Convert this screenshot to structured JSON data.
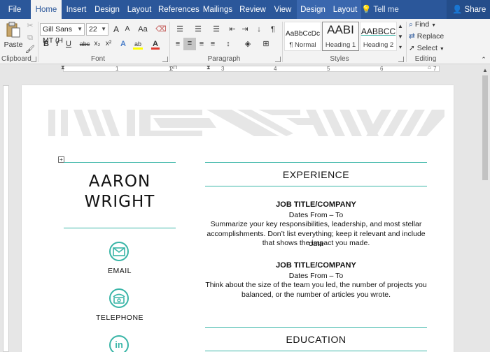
{
  "tabs": [
    {
      "label": "File"
    },
    {
      "label": "Home"
    },
    {
      "label": "Insert"
    },
    {
      "label": "Design"
    },
    {
      "label": "Layout"
    },
    {
      "label": "References"
    },
    {
      "label": "Mailings"
    },
    {
      "label": "Review"
    },
    {
      "label": "View"
    },
    {
      "label": "Design"
    },
    {
      "label": "Layout"
    }
  ],
  "tell_me": "Tell me",
  "share": "Share",
  "clipboard": {
    "paste": "Paste",
    "label": "Clipboard"
  },
  "font": {
    "name": "Gill Sans MT (H",
    "size": "22",
    "label": "Font",
    "bold": "B",
    "italic": "I",
    "underline": "U",
    "strike": "abc",
    "sub": "x₂",
    "sup": "x²",
    "grow": "A",
    "shrink": "A",
    "case": "Aa",
    "color_letter": "A",
    "highlight_letter": "ab"
  },
  "paragraph": {
    "label": "Paragraph",
    "pilcrow": "¶"
  },
  "styles": {
    "label": "Styles",
    "items": [
      {
        "sample": "AaBbCcDc",
        "name": "¶ Normal"
      },
      {
        "sample": "AABI",
        "name": "Heading 1"
      },
      {
        "sample": "AABBCC",
        "name": "Heading 2"
      }
    ]
  },
  "editing": {
    "label": "Editing",
    "find": "Find",
    "replace": "Replace",
    "select": "Select"
  },
  "ruler": {
    "numbers": [
      "1",
      "1",
      "2",
      "3",
      "4",
      "5",
      "6",
      "7"
    ]
  },
  "document": {
    "name_line1": "AARON",
    "name_line2": "WRIGHT",
    "contacts": [
      {
        "label": "EMAIL",
        "icon": "envelope-icon"
      },
      {
        "label": "TELEPHONE",
        "icon": "telephone-icon"
      },
      {
        "label": "",
        "icon": "linkedin-icon",
        "glyph": "in"
      }
    ],
    "experience_heading": "EXPERIENCE",
    "jobs": [
      {
        "title": "JOB TITLE/COMPANY",
        "dates": "Dates From – To",
        "lines": [
          "Summarize your key responsibilities, leadership, and most stellar",
          "accomplishments. Don’t list everything; keep it relevant and include data",
          "that shows the impact you made."
        ]
      },
      {
        "title": "JOB TITLE/COMPANY",
        "dates": "Dates From – To",
        "lines": [
          "Think about the size of the team you led, the number of projects you",
          "balanced, or the number of articles you wrote."
        ]
      }
    ],
    "education_heading": "EDUCATION"
  },
  "colors": {
    "accent": "#39b5a7",
    "ribbon_blue": "#2b579a",
    "banner_gray": "#e8e8e8"
  }
}
